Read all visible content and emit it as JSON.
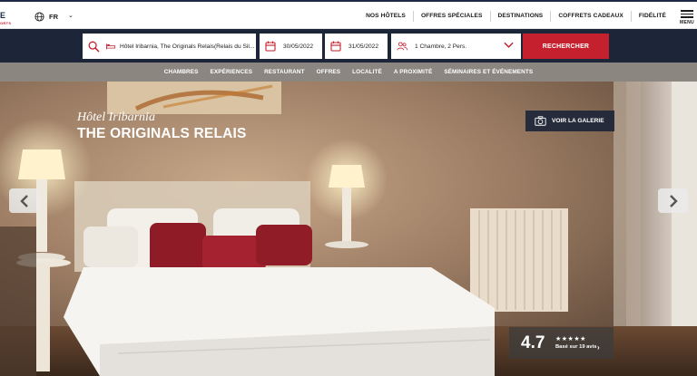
{
  "logo": {
    "mark": "E",
    "sub": "ORTS"
  },
  "language": {
    "code": "FR",
    "icon": "globe-icon"
  },
  "top_nav": [
    {
      "label": "NOS HÔTELS"
    },
    {
      "label": "OFFRES SPÉCIALES"
    },
    {
      "label": "DESTINATIONS"
    },
    {
      "label": "COFFRETS CADEAUX"
    },
    {
      "label": "FIDÉLITÉ"
    }
  ],
  "menu": {
    "label": "MENU"
  },
  "booking": {
    "hotel": "Hôtel Iribarnia, The Originals Relais(Relais du Sil...",
    "check_in": "30/05/2022",
    "check_out": "31/05/2022",
    "guests": "1 Chambre, 2 Pers.",
    "search_label": "RECHERCHER",
    "accent": "#c5202e",
    "bar_color": "#1d2638"
  },
  "sub_nav": [
    {
      "label": "CHAMBRES"
    },
    {
      "label": "EXPÉRIENCES"
    },
    {
      "label": "RESTAURANT"
    },
    {
      "label": "OFFRES"
    },
    {
      "label": "LOCALITÉ"
    },
    {
      "label": "A PROXIMITÉ"
    },
    {
      "label": "SÉMINAIRES ET ÉVÉNEMENTS"
    }
  ],
  "hero": {
    "subtitle": "Hôtel Iribarnia",
    "title": "THE ORIGINALS RELAIS",
    "gallery_label": "VOIR LA GALERIE",
    "rating": {
      "score": "4.7",
      "stars": "★★★★★",
      "count_text": "Basé sur 19 avis"
    }
  }
}
